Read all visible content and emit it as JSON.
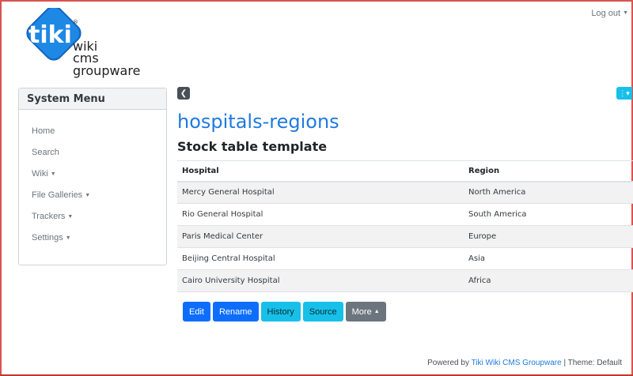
{
  "header": {
    "logo_word": "tiki",
    "logo_line1": "wiki",
    "logo_line2": "cms",
    "logo_line3": "groupware",
    "logo_reg": "®",
    "logout_label": "Log out"
  },
  "sidebar": {
    "title": "System Menu",
    "items": [
      {
        "label": "Home",
        "has_caret": false
      },
      {
        "label": "Search",
        "has_caret": false
      },
      {
        "label": "Wiki",
        "has_caret": true
      },
      {
        "label": "File Galleries",
        "has_caret": true
      },
      {
        "label": "Trackers",
        "has_caret": true
      },
      {
        "label": "Settings",
        "has_caret": true
      }
    ]
  },
  "main": {
    "page_title": "hospitals-regions",
    "subtitle": "Stock table template",
    "table": {
      "headers": [
        "Hospital",
        "Region"
      ],
      "rows": [
        [
          "Mercy General Hospital",
          "North America"
        ],
        [
          "Rio General Hospital",
          "South America"
        ],
        [
          "Paris Medical Center",
          "Europe"
        ],
        [
          "Beijing Central Hospital",
          "Asia"
        ],
        [
          "Cairo University Hospital",
          "Africa"
        ]
      ]
    },
    "actions": {
      "edit": "Edit",
      "rename": "Rename",
      "history": "History",
      "source": "Source",
      "more": "More"
    }
  },
  "footer": {
    "prefix": "Powered by",
    "link": "Tiki Wiki CMS Groupware",
    "theme": "| Theme: Default"
  },
  "icons": {
    "collapse": "chevron-left-icon",
    "page_menu": "vertical-dots-icon",
    "caret": "caret-down-icon"
  },
  "colors": {
    "accent": "#1f7ae0",
    "primary_button": "#0d6efd",
    "info_button": "#17c0e8",
    "secondary_button": "#6c757d",
    "logo_blue": "#1565c0"
  }
}
